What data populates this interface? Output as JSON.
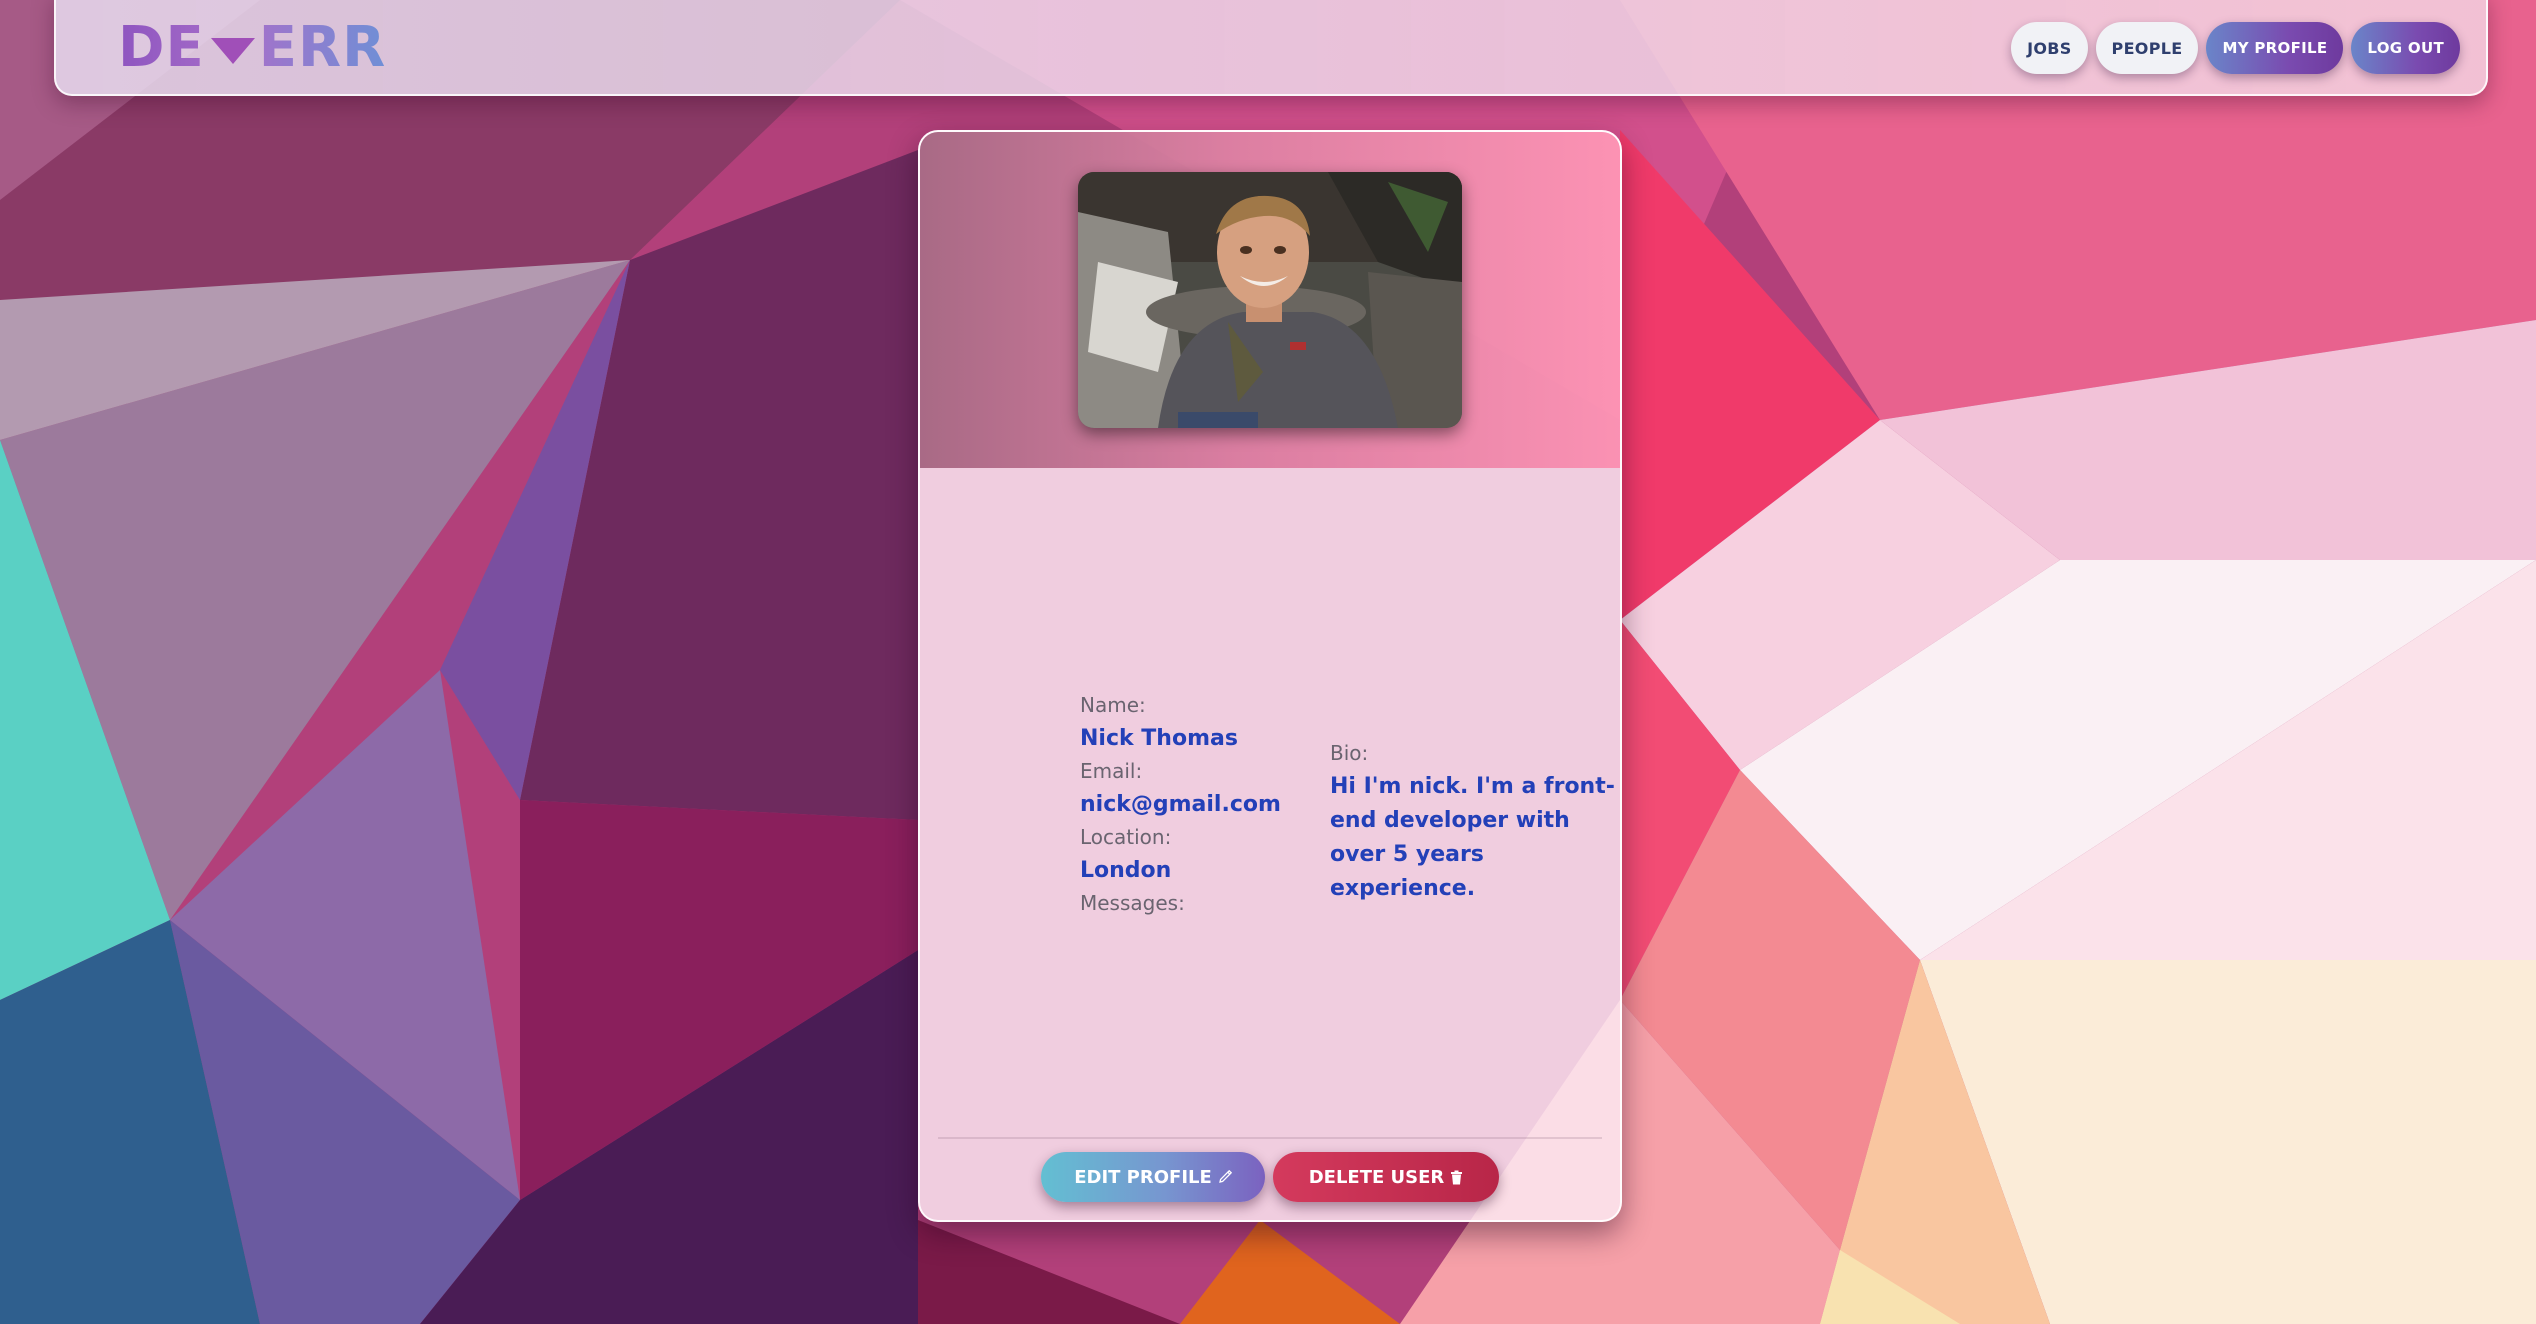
{
  "app": {
    "logo_left": "DE",
    "logo_right": "ERR",
    "logo_icon": "triangle-down-icon"
  },
  "nav": {
    "jobs": "JOBS",
    "people": "PEOPLE",
    "my_profile": "MY PROFILE",
    "log_out": "LOG OUT"
  },
  "profile": {
    "photo": "profile-photo",
    "name_label": "Name:",
    "name": "Nick Thomas",
    "email_label": "Email:",
    "email": "nick@gmail.com",
    "location_label": "Location:",
    "location": "London",
    "messages_label": "Messages:",
    "bio_label": "Bio:",
    "bio": "Hi I'm nick. I'm a front-end developer with over 5 years experience."
  },
  "actions": {
    "edit_label": "EDIT PROFILE",
    "edit_icon": "pencil-icon",
    "delete_label": "DELETE USER",
    "delete_icon": "trash-icon"
  },
  "colors": {
    "value_text": "#2340b8",
    "delete": "#c8304f"
  }
}
